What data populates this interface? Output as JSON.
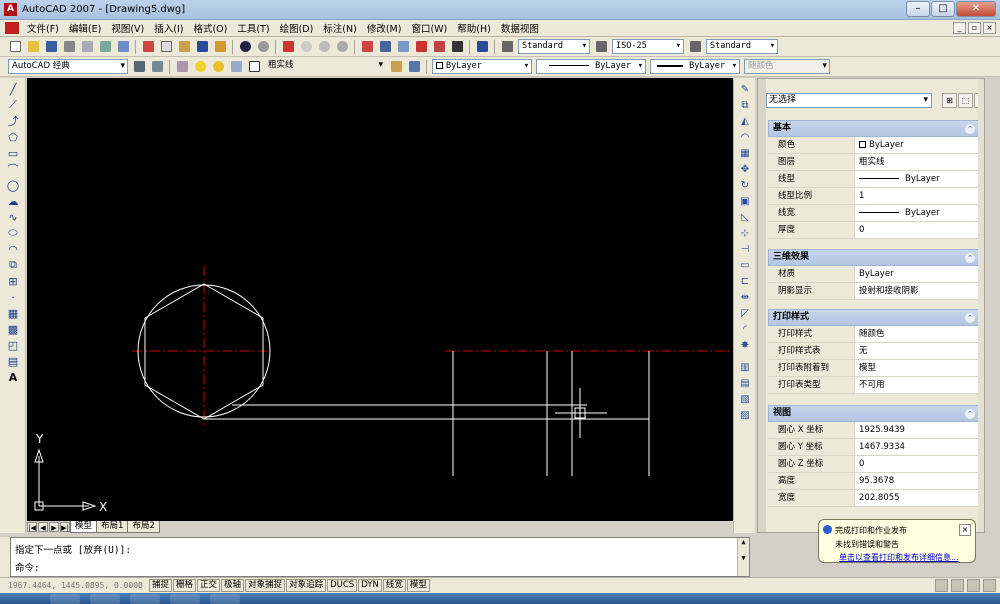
{
  "window": {
    "title": "AutoCAD 2007 - [Drawing5.dwg]",
    "app_badge": "A"
  },
  "menu": [
    "文件(F)",
    "编辑(E)",
    "视图(V)",
    "插入(I)",
    "格式(O)",
    "工具(T)",
    "绘图(D)",
    "标注(N)",
    "修改(M)",
    "窗口(W)",
    "帮助(H)",
    "数据视图"
  ],
  "toolbar1": {
    "text_style": "Standard",
    "dim_style": "ISO-25",
    "table_style": "Standard"
  },
  "toolbar2": {
    "workspace": "AutoCAD 经典",
    "layer": "粗实线",
    "color": "ByLayer",
    "linetype": "ByLayer",
    "lineweight": "ByLayer",
    "plotstyle": "随颜色"
  },
  "tabs": [
    "模型",
    "布局1",
    "布局2"
  ],
  "ucs": {
    "x": "X",
    "y": "Y"
  },
  "properties": {
    "selection": "无选择",
    "sections": [
      {
        "title": "基本",
        "rows": [
          {
            "name": "颜色",
            "value": "ByLayer",
            "kind": "color"
          },
          {
            "name": "图层",
            "value": "粗实线"
          },
          {
            "name": "线型",
            "value": "ByLayer",
            "kind": "line"
          },
          {
            "name": "线型比例",
            "value": "1"
          },
          {
            "name": "线宽",
            "value": "ByLayer",
            "kind": "line"
          },
          {
            "name": "厚度",
            "value": "0"
          }
        ]
      },
      {
        "title": "三维效果",
        "rows": [
          {
            "name": "材质",
            "value": "ByLayer"
          },
          {
            "name": "阴影显示",
            "value": "投射和接收阴影"
          }
        ]
      },
      {
        "title": "打印样式",
        "rows": [
          {
            "name": "打印样式",
            "value": "随颜色"
          },
          {
            "name": "打印样式表",
            "value": "无"
          },
          {
            "name": "打印表附着到",
            "value": "模型"
          },
          {
            "name": "打印表类型",
            "value": "不可用"
          }
        ]
      },
      {
        "title": "视图",
        "rows": [
          {
            "name": "圆心 X 坐标",
            "value": "1925.9439"
          },
          {
            "name": "圆心 Y 坐标",
            "value": "1467.9334"
          },
          {
            "name": "圆心 Z 坐标",
            "value": "0"
          },
          {
            "name": "高度",
            "value": "95.3678"
          },
          {
            "name": "宽度",
            "value": "202.8055"
          }
        ]
      }
    ]
  },
  "command": {
    "line1": "指定下一点或 [放弃(U)]:",
    "line2": "命令:"
  },
  "status": {
    "coords": "1967.4464, 1445.0895, 0.0000",
    "buttons": [
      "捕捉",
      "栅格",
      "正交",
      "极轴",
      "对象捕捉",
      "对象追踪",
      "DUCS",
      "DYN",
      "线宽",
      "模型"
    ]
  },
  "balloon": {
    "line1": "完成打印和作业发布",
    "line2": "未找到错误和警告",
    "link": "单击以查看打印和发布详细信息..."
  },
  "colors": {
    "canvas": "#000000",
    "centerline": "#cc0000",
    "geometry": "#ffffff",
    "props_header": "#b3c5e2"
  }
}
